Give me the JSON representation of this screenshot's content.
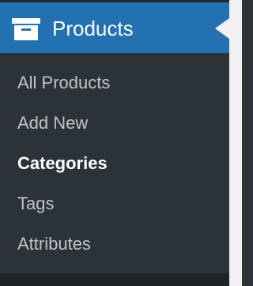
{
  "menu": {
    "title": "Products",
    "icon": "archive-box-icon",
    "colors": {
      "active_bg": "#2271b1",
      "submenu_bg": "#2c3338",
      "submenu_text": "#c3c4c7",
      "current_text": "#ffffff",
      "gutter": "#f0f0f1"
    },
    "items": [
      {
        "label": "All Products",
        "current": false
      },
      {
        "label": "Add New",
        "current": false
      },
      {
        "label": "Categories",
        "current": true
      },
      {
        "label": "Tags",
        "current": false
      },
      {
        "label": "Attributes",
        "current": false
      }
    ]
  }
}
